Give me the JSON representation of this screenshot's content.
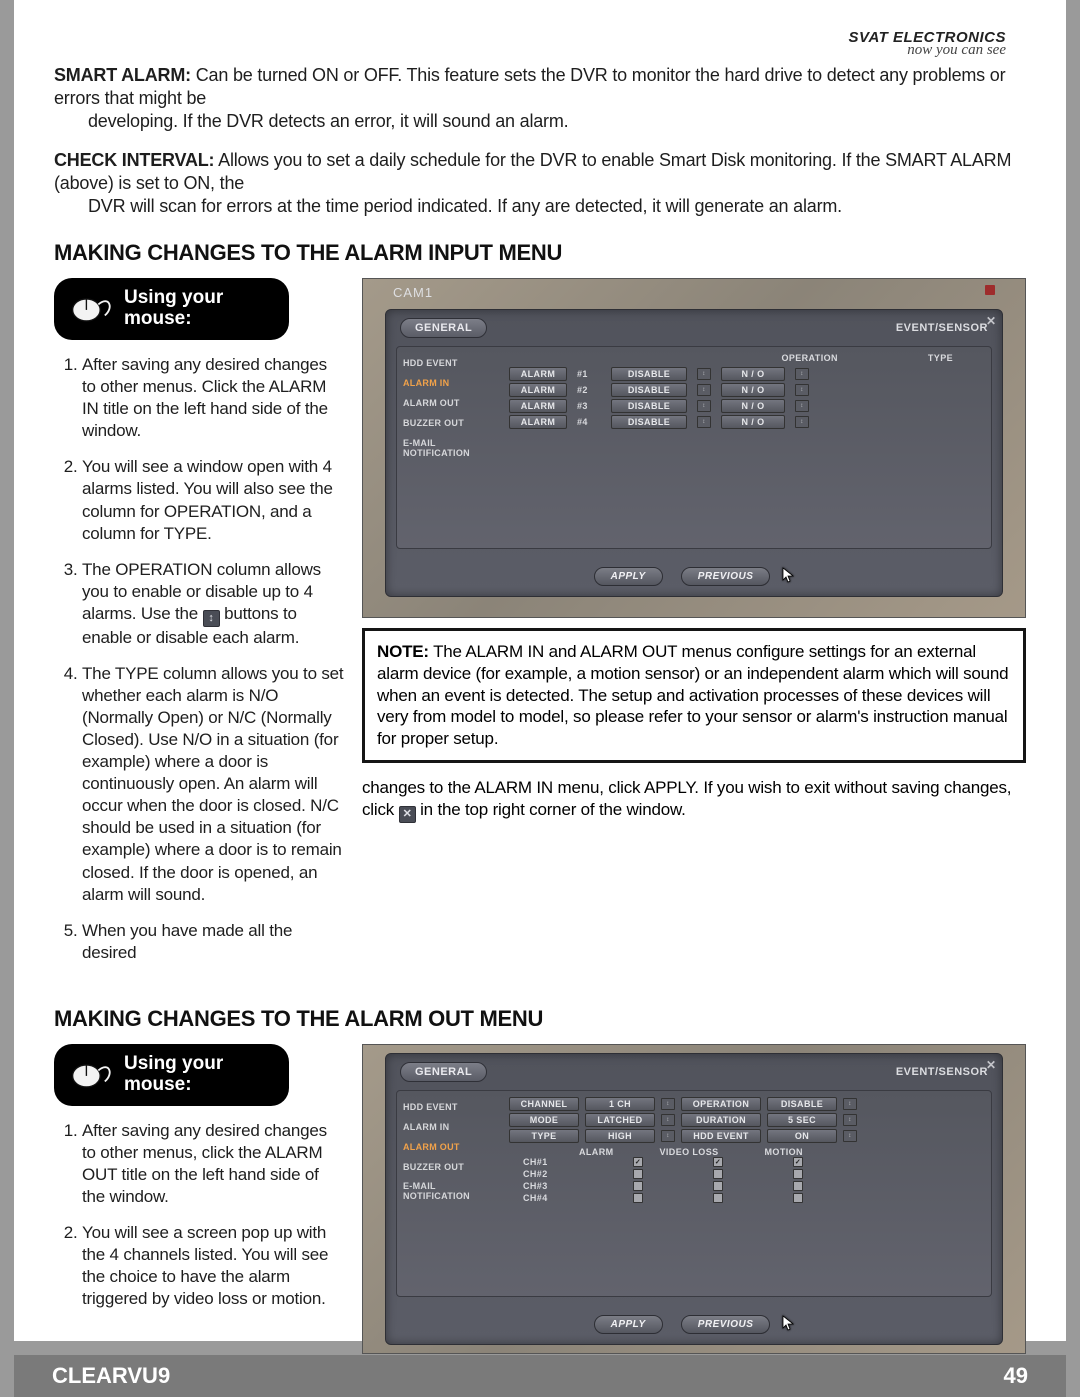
{
  "brand": {
    "name": "SVAT ELECTRONICS",
    "tagline": "now you can see"
  },
  "definitions": {
    "smart_alarm": {
      "label": "SMART ALARM:",
      "text1": "Can be turned ON or OFF.  This feature sets the DVR to monitor the hard drive to detect any problems or errors that might be",
      "text2": "developing.  If the DVR detects an error, it will sound an alarm."
    },
    "check_interval": {
      "label": "CHECK INTERVAL:",
      "text1": "Allows you to set a daily schedule for the DVR to enable Smart Disk monitoring.  If the SMART ALARM (above) is set to ON, the",
      "text2": "DVR will scan for errors at the time period indicated.  If any are detected, it will generate an alarm."
    }
  },
  "section1": {
    "heading": "MAKING CHANGES TO THE ALARM INPUT MENU",
    "mouse": {
      "line1": "Using your",
      "line2": "mouse:"
    },
    "steps": {
      "s1": "After saving any desired changes to other menus. Click the ALARM IN title on the left hand side of the window.",
      "s2": "You will see a window open with 4 alarms listed.  You will also see the column for OPERATION, and a column for TYPE.",
      "s3a": "The OPERATION column allows you to enable or disable up to 4 alarms.  Use the ",
      "s3b": " buttons to enable or disable each alarm.",
      "s4": "The TYPE column allows you to set whether each alarm is N/O (Normally Open) or N/C (Normally Closed).  Use N/O in a situation (for example) where a door is continuously open.  An alarm will occur when the door is closed.  N/C should be used in a situation (for example) where a door is to remain closed. If the door is opened, an alarm will sound.",
      "s5": "When you have made all the desired"
    },
    "flow_right": {
      "a": "changes to the ALARM IN menu, click APPLY.  If you wish to exit without saving changes, click ",
      "b": " in the top right corner of the window."
    },
    "note": {
      "label": "NOTE:",
      "text": "The ALARM IN and ALARM OUT menus configure settings for an external alarm device (for example, a motion sensor) or an independent alarm which will sound when an event is detected.  The setup and activation processes of these devices will very from model to model, so please refer to your sensor or alarm's instruction manual for proper setup."
    },
    "dvr": {
      "title_bar": "CAM1",
      "tab_left": "GENERAL",
      "tab_right": "EVENT/SENSOR",
      "side": [
        "HDD EVENT",
        "ALARM IN",
        "ALARM OUT",
        "BUZZER OUT",
        "E-MAIL NOTIFICATION"
      ],
      "side_selected": 1,
      "headers": {
        "operation": "OPERATION",
        "type": "TYPE"
      },
      "rows": [
        {
          "a": "ALARM",
          "n": "#1",
          "op": "DISABLE",
          "t": "N  /  O"
        },
        {
          "a": "ALARM",
          "n": "#2",
          "op": "DISABLE",
          "t": "N  /  O"
        },
        {
          "a": "ALARM",
          "n": "#3",
          "op": "DISABLE",
          "t": "N  /  O"
        },
        {
          "a": "ALARM",
          "n": "#4",
          "op": "DISABLE",
          "t": "N  /  O"
        }
      ],
      "apply": "APPLY",
      "previous": "PREVIOUS"
    }
  },
  "section2": {
    "heading": "MAKING CHANGES TO THE ALARM OUT MENU",
    "mouse": {
      "line1": "Using your",
      "line2": "mouse:"
    },
    "steps": {
      "s1": "After saving any desired changes to other menus, click the ALARM OUT title on the left hand side of the window.",
      "s2": "You will see a screen pop up with the 4 channels listed.  You will see the choice to have the alarm triggered by video loss or motion."
    },
    "dvr": {
      "tab_left": "GENERAL",
      "tab_right": "EVENT/SENSOR",
      "side": [
        "HDD EVENT",
        "ALARM IN",
        "ALARM OUT",
        "BUZZER OUT",
        "E-MAIL NOTIFICATION"
      ],
      "side_selected": 2,
      "top_rows": [
        {
          "l": "CHANNEL",
          "v": "1  CH",
          "l2": "OPERATION",
          "v2": "DISABLE"
        },
        {
          "l": "MODE",
          "v": "LATCHED",
          "l2": "DURATION",
          "v2": "5  SEC"
        },
        {
          "l": "TYPE",
          "v": "HIGH",
          "l2": "HDD EVENT",
          "v2": "ON"
        }
      ],
      "check_headers": {
        "alarm": "ALARM",
        "video": "VIDEO LOSS",
        "motion": "MOTION"
      },
      "check_rows": [
        {
          "ch": "CH#1",
          "a": true,
          "v": true,
          "m": true
        },
        {
          "ch": "CH#2",
          "a": false,
          "v": false,
          "m": false
        },
        {
          "ch": "CH#3",
          "a": false,
          "v": false,
          "m": false
        },
        {
          "ch": "CH#4",
          "a": false,
          "v": false,
          "m": false
        }
      ],
      "apply": "APPLY",
      "previous": "PREVIOUS"
    }
  },
  "footer": {
    "model": "CLEARVU9",
    "page": "49"
  }
}
